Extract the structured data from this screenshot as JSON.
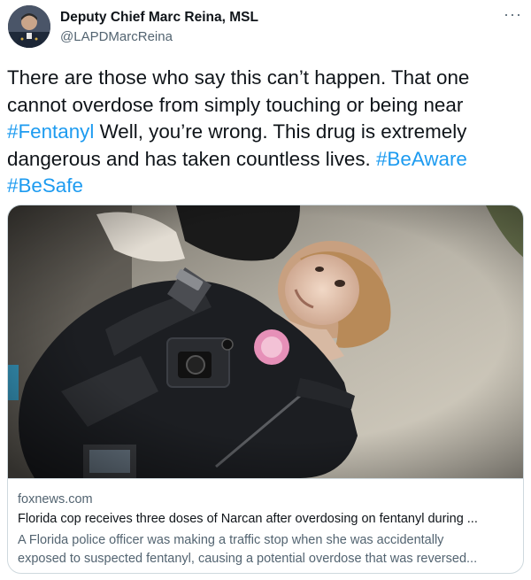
{
  "author": {
    "name": "Deputy Chief Marc Reina, MSL",
    "handle": "@LAPDMarcReina",
    "avatar_icon": "profile-photo"
  },
  "more_label": "···",
  "tweet": {
    "part1": "There are those who say this can’t happen. That one cannot overdose from simply touching or being near ",
    "hashtag1": "#Fentanyl",
    "part2": "  Well, you’re wrong. This drug is extremely dangerous and has taken countless lives. ",
    "hashtag2": "#BeAware",
    "hashtag3": "#BeSafe"
  },
  "link_card": {
    "domain": "foxnews.com",
    "title": "Florida cop receives three doses of Narcan after overdosing on fentanyl during ...",
    "description_line1": "A Florida police officer was making a traffic stop when she was accidentally",
    "description_line2": "exposed to suspected fentanyl, causing a potential overdose that was reversed...",
    "image_description_icon": "bodycam-photo"
  },
  "colors": {
    "accent": "#1d9bf0",
    "text": "#0f1419",
    "secondary": "#536471",
    "border": "#cfd9de"
  }
}
